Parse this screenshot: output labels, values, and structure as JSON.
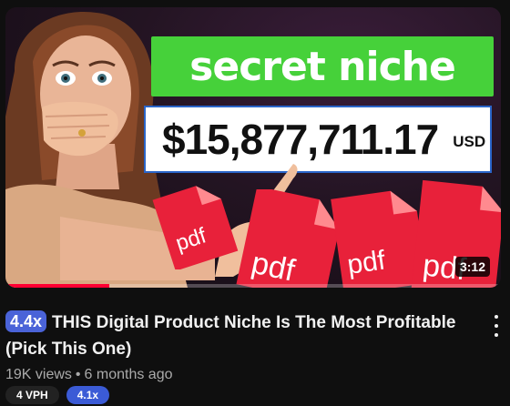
{
  "thumbnail": {
    "headline": "secret niche",
    "amount": "$15,877,711.17",
    "currency": "USD",
    "file_label": "pdf",
    "duration": "3:12",
    "watch_progress": 0.21,
    "colors": {
      "headline_bg": "#46d13a",
      "file_red": "#e8213a",
      "progress_red": "#ff0033"
    }
  },
  "video": {
    "outlier_badge": "4.4x",
    "title": "THIS Digital Product Niche Is The Most Profitable (Pick This One)",
    "views": "19K views",
    "separator": "•",
    "age": "6 months ago",
    "menu_icon": "vertical-ellipsis-icon"
  },
  "stats_chips": {
    "vph": "4 VPH",
    "multiplier": "4.1x"
  }
}
